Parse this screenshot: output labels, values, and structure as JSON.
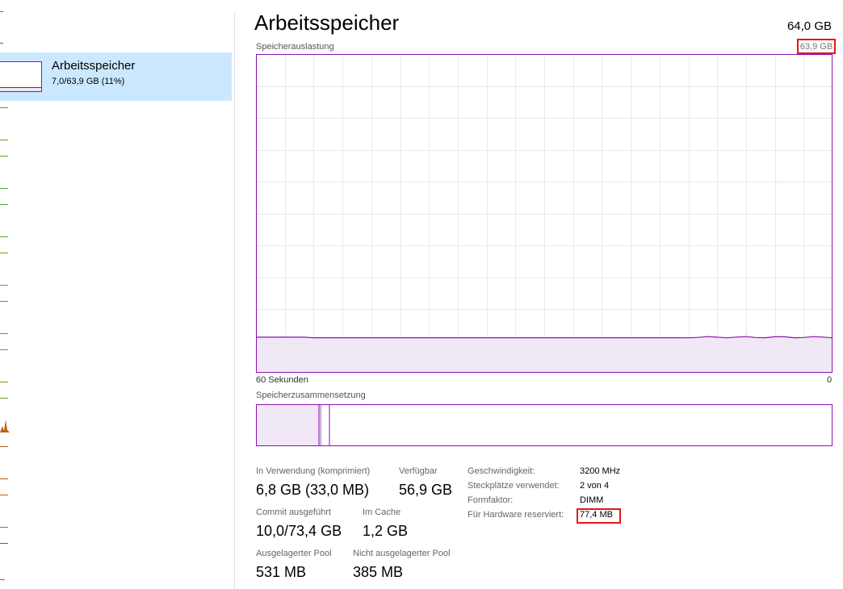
{
  "sidebar": {
    "selected": {
      "title": "Arbeitsspeicher",
      "subtitle": "7,0/63,9 GB (11%)"
    }
  },
  "header": {
    "title": "Arbeitsspeicher",
    "total_capacity": "64,0 GB"
  },
  "usage_graph": {
    "label": "Speicherauslastung",
    "max_label": "63,9 GB",
    "x_left": "60 Sekunden",
    "x_right": "0",
    "usage_fraction": 0.11,
    "line_color": "#8b12ae",
    "fill_color": "#f1e8f6"
  },
  "composition": {
    "label": "Speicherzusammensetzung"
  },
  "stats": {
    "in_use": {
      "label": "In Verwendung (komprimiert)",
      "value": "6,8 GB (33,0 MB)"
    },
    "available": {
      "label": "Verfügbar",
      "value": "56,9 GB"
    },
    "committed": {
      "label": "Commit ausgeführt",
      "value": "10,0/73,4 GB"
    },
    "cached": {
      "label": "Im Cache",
      "value": "1,2 GB"
    },
    "paged_pool": {
      "label": "Ausgelagerter Pool",
      "value": "531 MB"
    },
    "nonpaged_pool": {
      "label": "Nicht ausgelagerter Pool",
      "value": "385 MB"
    }
  },
  "properties": {
    "speed": {
      "label": "Geschwindigkeit:",
      "value": "3200 MHz"
    },
    "slots": {
      "label": "Steckplätze verwendet:",
      "value": "2 von 4"
    },
    "form_factor": {
      "label": "Formfaktor:",
      "value": "DIMM"
    },
    "hw_reserved": {
      "label": "Für Hardware reserviert:",
      "value": "77,4 MB"
    }
  },
  "highlight_color": "#e8141b"
}
